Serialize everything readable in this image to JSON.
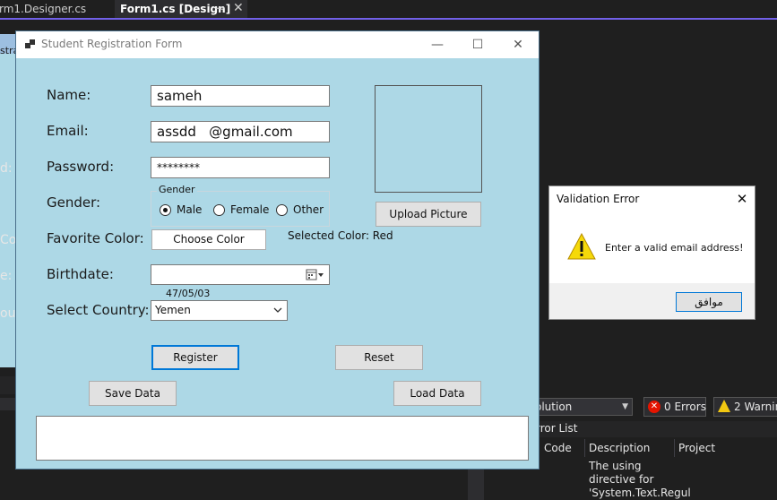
{
  "ide": {
    "tabs": [
      {
        "label": "rm1.Designer.cs"
      },
      {
        "label": "Form1.cs [Design]"
      }
    ],
    "background_labels": [
      "stra",
      "d:",
      "Co",
      "e:",
      "ou"
    ],
    "error_list": {
      "scope": "olution",
      "errors": "0 Errors",
      "warnings": "2 Warnin",
      "title": "rror List",
      "columns": [
        "Code",
        "Description",
        "Project"
      ],
      "rows": [
        {
          "description": "The using directive for 'System.Text.Regul"
        }
      ]
    }
  },
  "form": {
    "title": "Student Registration Form",
    "labels": {
      "name": "Name:",
      "email": "Email:",
      "password": "Password:",
      "gender": "Gender:",
      "favorite_color": "Favorite Color:",
      "birthdate": "Birthdate:",
      "country": "Select Country:"
    },
    "values": {
      "name": "sameh",
      "email": "assdd   @gmail.com",
      "password": "********",
      "birthdate": "47/05/03",
      "country": "Yemen",
      "selected_color": "Selected Color: Red"
    },
    "gender_group": {
      "caption": "Gender",
      "options": [
        "Male",
        "Female",
        "Other"
      ],
      "selected": "Male"
    },
    "buttons": {
      "choose_color": "Choose Color",
      "upload_picture": "Upload Picture",
      "register": "Register",
      "reset": "Reset",
      "save_data": "Save Data",
      "load_data": "Load Data"
    }
  },
  "dialog": {
    "title": "Validation Error",
    "message": "Enter a valid email address!",
    "ok": "موافق"
  },
  "colors": {
    "form_bg": "#add8e6",
    "accent": "#7160e8",
    "focus": "#0078d7"
  }
}
